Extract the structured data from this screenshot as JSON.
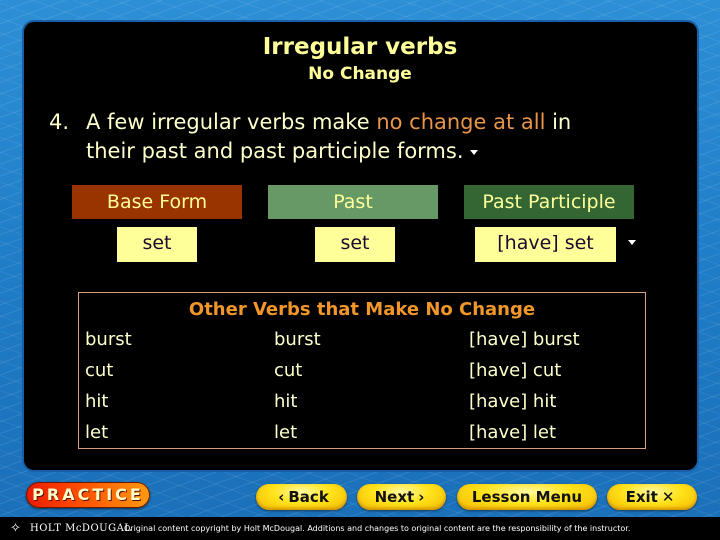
{
  "slide": {
    "title": "Irregular verbs",
    "subtitle": "No Change",
    "point": {
      "number": "4.",
      "text_before": "A few irregular verbs make ",
      "highlight": "no change at all",
      "text_after": " in",
      "line2": "their past and past participle forms."
    },
    "colors": {
      "highlight": "#e8954a",
      "base_header": "#993300",
      "past_header": "#669966",
      "participle_header": "#336633",
      "cell_bg": "#ffff99"
    }
  },
  "example": {
    "headers": [
      "Base Form",
      "Past",
      "Past Participle"
    ],
    "values": [
      "set",
      "set",
      "[have] set"
    ]
  },
  "other_verbs": {
    "title": "Other Verbs that Make No Change",
    "rows": [
      [
        "burst",
        "burst",
        "[have] burst"
      ],
      [
        "cut",
        "cut",
        "[have] cut"
      ],
      [
        "hit",
        "hit",
        "[have] hit"
      ],
      [
        "let",
        "let",
        "[have] let"
      ]
    ]
  },
  "nav": {
    "practice": "PRACTICE",
    "back": "Back",
    "next": "Next",
    "lesson_menu": "Lesson Menu",
    "exit": "Exit",
    "back_icon": "‹",
    "next_icon": "›",
    "exit_icon": "✕"
  },
  "footer": {
    "brand": "HOLT McDOUGAL",
    "copyright": "Original content copyright by Holt McDougal. Additions and changes to original content are the responsibility of the instructor."
  }
}
